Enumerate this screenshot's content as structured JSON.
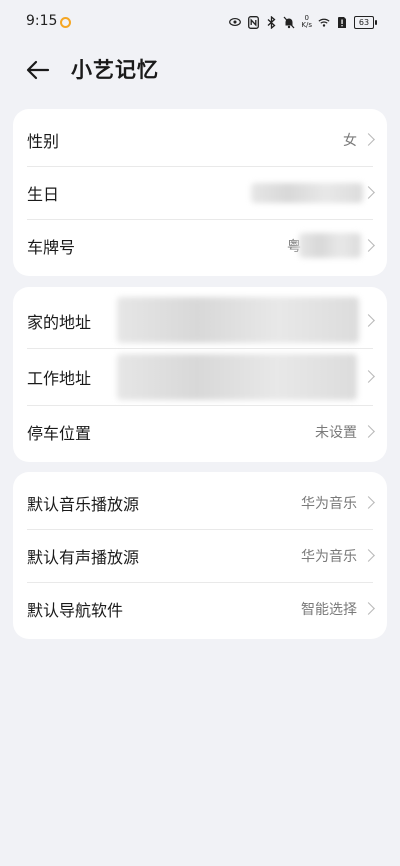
{
  "status_bar": {
    "time": "9:15",
    "speed_value": "0",
    "speed_unit": "K/s",
    "battery": "63"
  },
  "header": {
    "title": "小艺记忆"
  },
  "card1": {
    "gender_label": "性别",
    "gender_value": "女",
    "birthday_label": "生日",
    "plate_label": "车牌号",
    "plate_prefix": "粤"
  },
  "card2": {
    "home_label": "家的地址",
    "work_label": "工作地址",
    "parking_label": "停车位置",
    "parking_value": "未设置"
  },
  "card3": {
    "music_label": "默认音乐播放源",
    "music_value": "华为音乐",
    "audio_label": "默认有声播放源",
    "audio_value": "华为音乐",
    "nav_label": "默认导航软件",
    "nav_value": "智能选择"
  },
  "colors": {
    "background": "#f1f2f6",
    "card": "#ffffff",
    "text_primary": "#1a1a1a",
    "text_secondary": "#7a7a7a",
    "status_dot": "#f5a623"
  }
}
